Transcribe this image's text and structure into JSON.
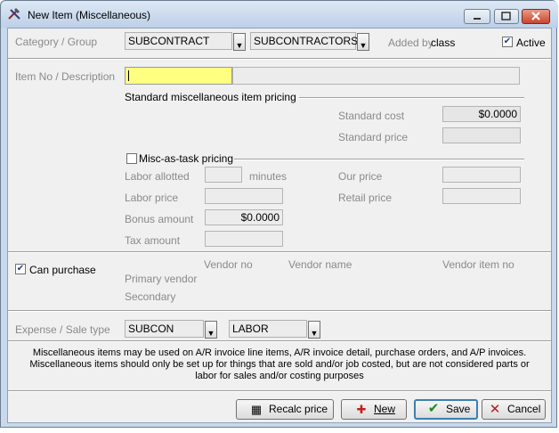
{
  "window": {
    "title": "New Item (Miscellaneous)",
    "icon": "wrench-hammer-icon"
  },
  "category": {
    "label": "Category / Group",
    "category_value": "SUBCONTRACT",
    "group_value": "SUBCONTRACTORS",
    "added_by_label": "Added by",
    "added_by_value": "class",
    "active_label": "Active",
    "active_checked": true
  },
  "item": {
    "label": "Item No / Description",
    "item_no_value": "",
    "description_value": ""
  },
  "standard_pricing": {
    "section_label": "Standard miscellaneous item pricing",
    "cost_label": "Standard cost",
    "cost_value": "$0.0000",
    "price_label": "Standard price",
    "price_value": ""
  },
  "task_pricing": {
    "checkbox_label": "Misc-as-task pricing",
    "checked": false,
    "labor_allotted_label": "Labor allotted",
    "labor_allotted_value": "",
    "minutes_label": "minutes",
    "labor_price_label": "Labor price",
    "labor_price_value": "",
    "bonus_amount_label": "Bonus amount",
    "bonus_amount_value": "$0.0000",
    "tax_amount_label": "Tax amount",
    "tax_amount_value": "",
    "our_price_label": "Our price",
    "our_price_value": "",
    "retail_price_label": "Retail price",
    "retail_price_value": ""
  },
  "purchase": {
    "can_purchase_label": "Can purchase",
    "can_purchase_checked": true,
    "col_vendor_no": "Vendor no",
    "col_vendor_name": "Vendor name",
    "col_vendor_item_no": "Vendor item no",
    "primary_vendor_label": "Primary vendor",
    "secondary_label": "Secondary"
  },
  "expense": {
    "label": "Expense / Sale type",
    "expense_value": "SUBCON",
    "sale_value": "LABOR"
  },
  "info_text": {
    "line1": "Miscellaneous items may be used on A/R invoice line items, A/R invoice detail, purchase orders, and A/P invoices.",
    "line2": "Miscellaneous items should only be set up for things that are sold and/or job costed, but are not considered parts or",
    "line3": "labor for sales and/or costing purposes"
  },
  "buttons": {
    "recalc_label": "Recalc price",
    "new_label": "New",
    "save_label": "Save",
    "cancel_label": "Cancel"
  },
  "colors": {
    "active_field": "#ffff80",
    "save_border": "#3c7fb1",
    "close_button": "#c8462d"
  }
}
